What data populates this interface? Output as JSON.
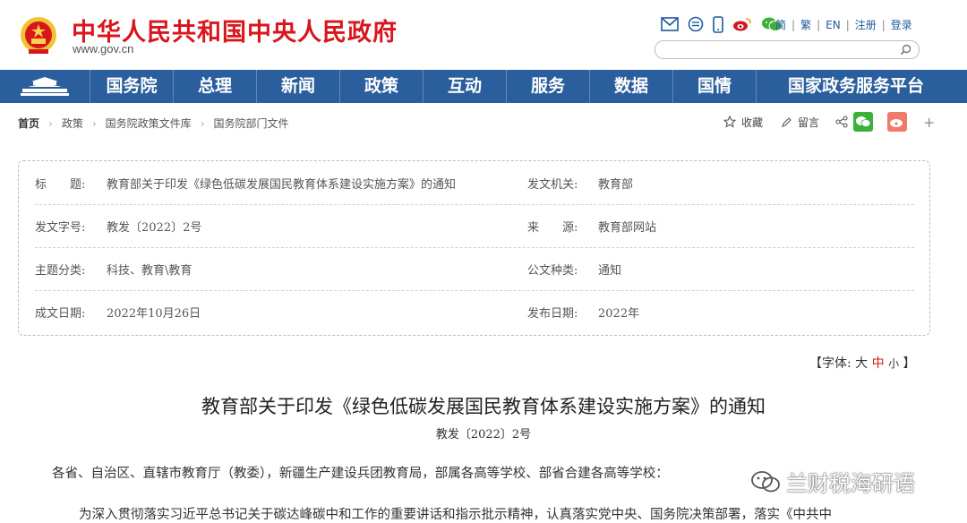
{
  "header": {
    "site_title": "中华人民共和国中央人民政府",
    "site_url": "www.gov.cn",
    "tool_icons": [
      "mail-icon",
      "message-icon",
      "mobile-icon",
      "weibo-icon",
      "wechat-icon"
    ],
    "lang_links": [
      "简",
      "繁",
      "EN",
      "注册",
      "登录"
    ],
    "search": {
      "placeholder": ""
    }
  },
  "nav": {
    "items": [
      "国务院",
      "总理",
      "新闻",
      "政策",
      "互动",
      "服务",
      "数据",
      "国情",
      "国家政务服务平台"
    ]
  },
  "breadcrumb": {
    "items": [
      "首页",
      "政策",
      "国务院政策文件库",
      "国务院部门文件"
    ]
  },
  "share": {
    "favorite": "收藏",
    "comment": "留言",
    "plus": "+"
  },
  "meta": {
    "rows": [
      {
        "label1": "标　　题:",
        "value1": "教育部关于印发《绿色低碳发展国民教育体系建设实施方案》的通知",
        "label2": "发文机关:",
        "value2": "教育部"
      },
      {
        "label1": "发文字号:",
        "value1": "教发〔2022〕2号",
        "label2": "来　　源:",
        "value2": "教育部网站"
      },
      {
        "label1": "主题分类:",
        "value1": "科技、教育\\教育",
        "label2": "公文种类:",
        "value2": "通知"
      },
      {
        "label1": "成文日期:",
        "value1": "2022年10月26日",
        "label2": "发布日期:",
        "value2": "2022年"
      }
    ]
  },
  "font_control": {
    "open": "【字体:",
    "large": "大",
    "medium": "中",
    "small": "小",
    "close": "】"
  },
  "article": {
    "title": "教育部关于印发《绿色低碳发展国民教育体系建设实施方案》的通知",
    "doc_no": "教发〔2022〕2号",
    "para1": "各省、自治区、直辖市教育厅（教委），新疆生产建设兵团教育局，部属各高等学校、部省合建各高等学校：",
    "para2": "为深入贯彻落实习近平总书记关于碳达峰碳中和工作的重要讲话和指示批示精神，认真落实党中央、国务院决策部署，落实《中共中"
  },
  "watermark": {
    "text": "兰财税海研语"
  },
  "colors": {
    "brand_red": "#d8161c",
    "nav_blue": "#2a5e9d",
    "link_blue": "#1f5a9d"
  }
}
